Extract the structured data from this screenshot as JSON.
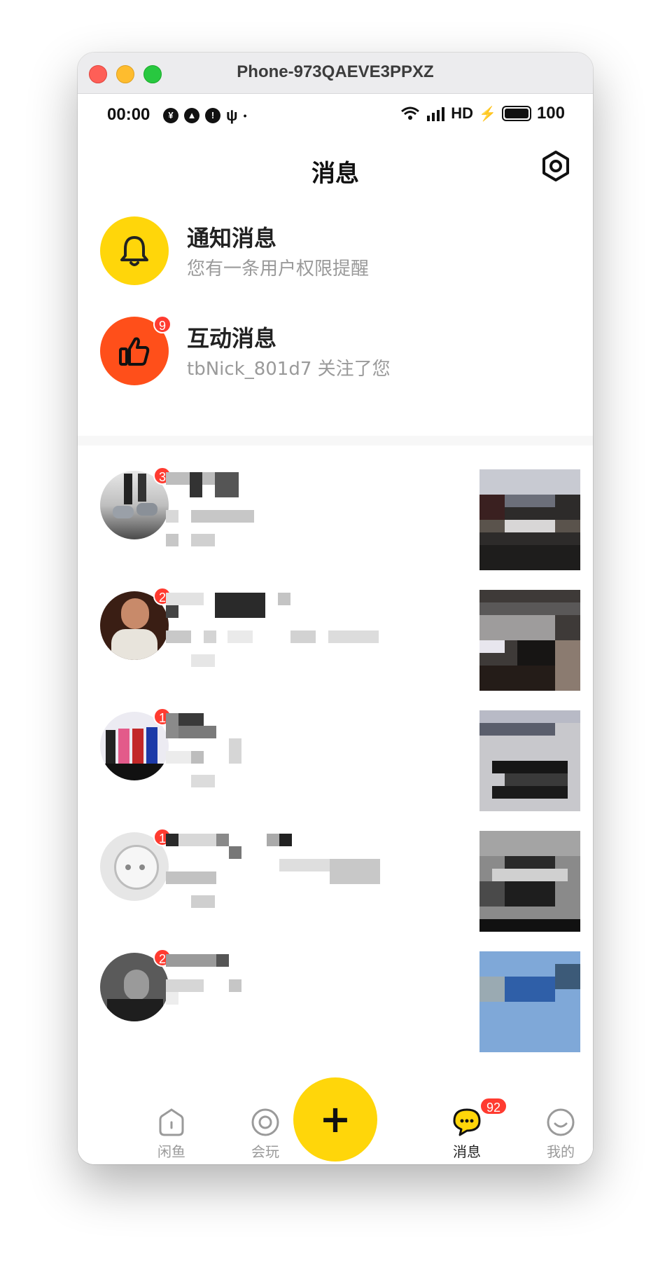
{
  "window": {
    "title": "Phone-973QAEVE3PPXZ"
  },
  "status_bar": {
    "time": "00:00",
    "network": "HD",
    "battery": "100"
  },
  "header": {
    "title": "消息"
  },
  "system_messages": [
    {
      "title": "通知消息",
      "subtitle": "您有一条用户权限提醒",
      "badge": "",
      "icon": "bell-icon",
      "color": "#ffd60a"
    },
    {
      "title": "互动消息",
      "subtitle": "tbNick_801d7 关注了您",
      "badge": "9",
      "icon": "thumbs-up-icon",
      "color": "#ff4f1a"
    }
  ],
  "conversations": [
    {
      "badge": "3"
    },
    {
      "badge": "2"
    },
    {
      "badge": "1"
    },
    {
      "badge": "1"
    },
    {
      "badge": "2"
    }
  ],
  "tab_bar": {
    "tabs": [
      {
        "label": "闲鱼",
        "icon": "home-icon"
      },
      {
        "label": "会玩",
        "icon": "play-circle-icon"
      },
      {
        "label": "消息",
        "icon": "chat-icon",
        "badge": "92",
        "active": true
      },
      {
        "label": "我的",
        "icon": "smile-icon"
      }
    ],
    "post_symbol": "+"
  },
  "colors": {
    "accent": "#ffd60a",
    "badge": "#ff3b30",
    "orange": "#ff4f1a"
  }
}
